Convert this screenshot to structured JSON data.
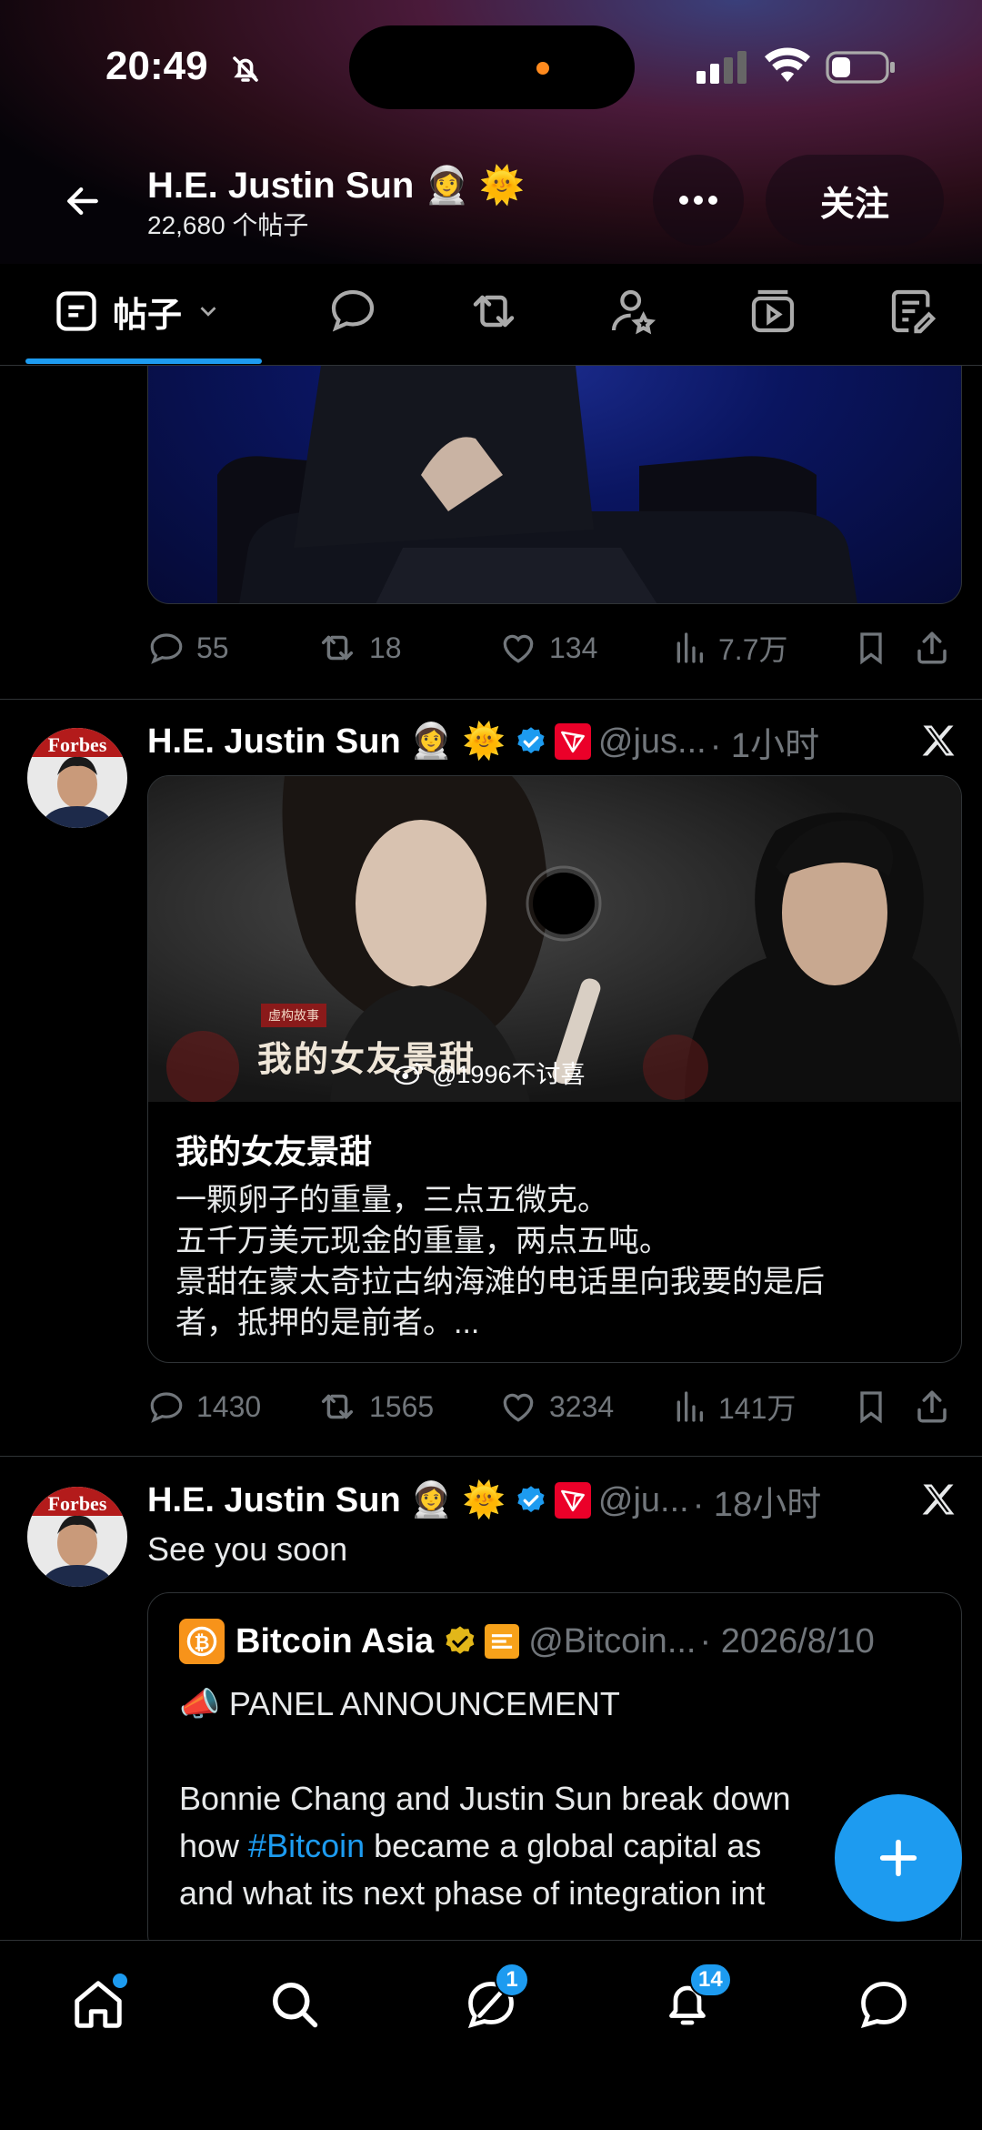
{
  "status_bar": {
    "time": "20:49"
  },
  "header": {
    "name": "H.E. Justin Sun 👩‍🚀 🌞",
    "post_count": "22,680 个帖子",
    "follow_label": "关注"
  },
  "tabs": {
    "active_label": "帖子"
  },
  "tweets": [
    {
      "stats": {
        "replies": "55",
        "retweets": "18",
        "likes": "134",
        "views": "7.7万"
      }
    },
    {
      "name": "H.E. Justin Sun",
      "emoji": "👩‍🚀 🌞",
      "handle": "@jus...",
      "time": "· 1小时",
      "card": {
        "image_caption": "我的女友景甜",
        "image_tag": "虚构故事",
        "watermark": "@1996不讨喜",
        "title": "我的女友景甜",
        "body_1": "一颗卵子的重量，三点五微克。",
        "body_2": "五千万美元现金的重量，两点五吨。",
        "body_3": "景甜在蒙太奇拉古纳海滩的电话里向我要的是后",
        "body_4": "者，抵押的是前者。..."
      },
      "stats": {
        "replies": "1430",
        "retweets": "1565",
        "likes": "3234",
        "views": "141万"
      }
    },
    {
      "name": "H.E. Justin Sun",
      "emoji": "👩‍🚀 🌞",
      "handle": "@ju...",
      "time": "· 18小时",
      "text": "See you soon",
      "quote": {
        "name": "Bitcoin Asia",
        "handle": "@Bitcoin...",
        "date": "· 2026/8/10",
        "line1": "📣 PANEL ANNOUNCEMENT",
        "line2": "Bonnie Chang and Justin Sun break down",
        "line3_pre": "how ",
        "line3_tag": "#Bitcoin",
        "line3_post": " became a global capital as",
        "line4": "and what its next phase of integration int"
      }
    }
  ],
  "nav": {
    "messages_badge": "1",
    "notifications_badge": "14"
  },
  "colors": {
    "accent": "#1d9bf0",
    "muted": "#71767b",
    "border": "#2f3336"
  }
}
